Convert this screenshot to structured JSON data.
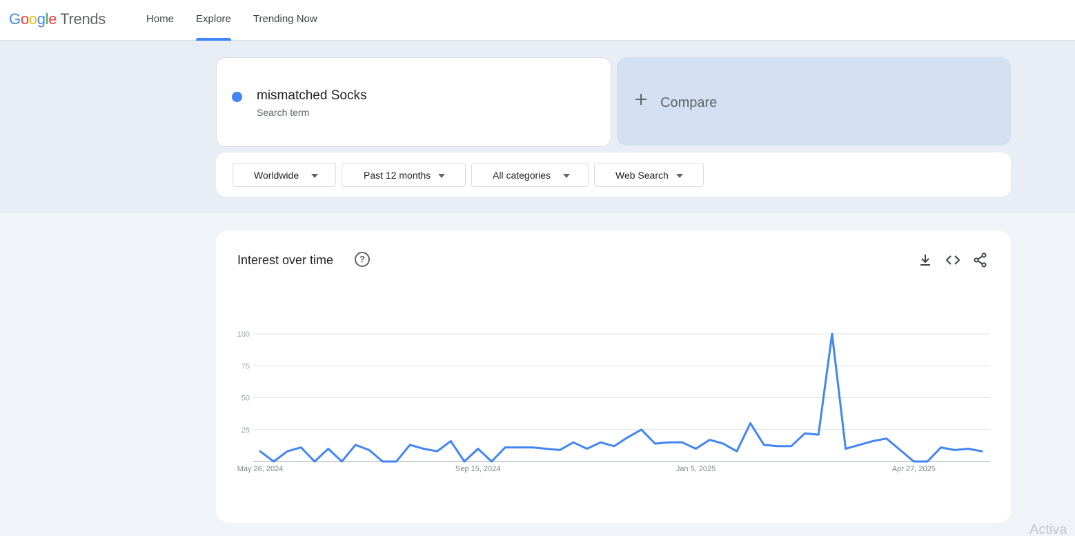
{
  "header": {
    "logo_google": [
      "G",
      "o",
      "o",
      "g",
      "l",
      "e"
    ],
    "logo_product": "Trends",
    "nav": [
      {
        "label": "Home",
        "active": false
      },
      {
        "label": "Explore",
        "active": true
      },
      {
        "label": "Trending Now",
        "active": false
      }
    ]
  },
  "search": {
    "term": "mismatched Socks",
    "subtitle": "Search term",
    "term_color": "#4285f4",
    "compare_label": "Compare"
  },
  "filters": [
    {
      "label": "Worldwide"
    },
    {
      "label": "Past 12 months"
    },
    {
      "label": "All categories"
    },
    {
      "label": "Web Search"
    }
  ],
  "chart": {
    "title": "Interest over time",
    "help_icon": "help-circle-icon",
    "tools": [
      "download-icon",
      "embed-code-icon",
      "share-icon"
    ]
  },
  "chart_data": {
    "type": "line",
    "title": "Interest over time",
    "xlabel": "",
    "ylabel": "",
    "ylim": [
      0,
      100
    ],
    "yticks": [
      25,
      50,
      75,
      100
    ],
    "x_tick_labels": [
      "May 26, 2024",
      "Sep 15, 2024",
      "Jan 5, 2025",
      "Apr 27, 2025"
    ],
    "x_tick_indices": [
      0,
      16,
      32,
      48
    ],
    "grid": true,
    "series": [
      {
        "color": "#4285f4",
        "values": [
          8,
          0,
          8,
          11,
          0,
          10,
          0,
          13,
          9,
          0,
          0,
          13,
          10,
          8,
          16,
          0,
          10,
          0,
          11,
          11,
          11,
          10,
          9,
          15,
          10,
          15,
          12,
          19,
          25,
          14,
          15,
          15,
          10,
          17,
          14,
          8,
          30,
          13,
          12,
          12,
          22,
          21,
          100,
          10,
          13,
          16,
          18,
          9,
          0,
          0,
          11,
          9,
          10,
          8
        ]
      }
    ]
  },
  "overlay": {
    "watermark": "Activa"
  }
}
